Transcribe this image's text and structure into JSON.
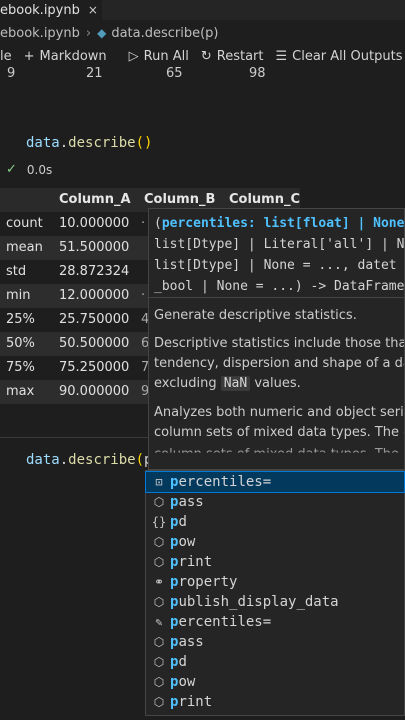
{
  "tab": {
    "title": "ebook.ipynb",
    "close_glyph": "×"
  },
  "breadcrumb": {
    "file": "ebook.ipynb",
    "separator": "›",
    "symbol": "data.describe(p)"
  },
  "toolbar": {
    "items": [
      {
        "label": "le",
        "icon": ""
      },
      {
        "label": "Markdown",
        "icon": "+"
      },
      {
        "label": "Run All",
        "icon": "▷"
      },
      {
        "label": "Restart",
        "icon": "↻"
      },
      {
        "label": "Clear All Outputs",
        "icon": "☰"
      }
    ]
  },
  "prev_output": [
    "9",
    "21",
    "65",
    "98"
  ],
  "code_cell_1": {
    "var": "data",
    "dot": ".",
    "fn": "describe",
    "args": "()"
  },
  "exec_status": {
    "time": "0.0s"
  },
  "dataframe": {
    "columns": [
      "Column_A",
      "Column_B",
      "Column_C"
    ],
    "rows": [
      {
        "index": "count",
        "value": "10.000000",
        "cut": "·"
      },
      {
        "index": "mean",
        "value": "51.500000",
        "cut": ""
      },
      {
        "index": "std",
        "value": "28.872324",
        "cut": ""
      },
      {
        "index": "min",
        "value": "12.000000",
        "cut": "·"
      },
      {
        "index": "25%",
        "value": "25.750000",
        "cut": "4"
      },
      {
        "index": "50%",
        "value": "50.500000",
        "cut": "6"
      },
      {
        "index": "75%",
        "value": "75.250000",
        "cut": "7"
      },
      {
        "index": "max",
        "value": "90.000000",
        "cut": "9"
      }
    ]
  },
  "code_cell_2": {
    "var": "data",
    "dot": ".",
    "fn": "describe",
    "open": "(",
    "typed": "p",
    "close": ")"
  },
  "hover": {
    "sig_line1_paren": "(",
    "sig_line1_param": "percentiles: list[float] | None",
    "sig_line2": "list[Dtype] | Literal['all'] | N",
    "sig_line3": "list[Dtype] | None = ..., datet",
    "sig_line4": "_bool | None = ...) -> DataFrame",
    "doc_summary": "Generate descriptive statistics.",
    "doc_p1_l1": "Descriptive statistics include those that s",
    "doc_p1_l2": "tendency, dispersion and shape of a data",
    "doc_p1_l3_pre": "excluding ",
    "doc_p1_l3_code": "NaN",
    "doc_p1_l3_post": " values.",
    "doc_p2_l1": "Analyzes both numeric and object series",
    "doc_p2_l2": "column sets of mixed data types. The ou",
    "doc_p2_l3": "column sets of mixed data types. The ou"
  },
  "suggestions": [
    {
      "match": "p",
      "rest": "ercentiles=",
      "icon": "variable-icon",
      "glyph": "⊡",
      "selected": true
    },
    {
      "match": "p",
      "rest": "ass",
      "icon": "keyword-icon",
      "glyph": "⬡",
      "selected": false
    },
    {
      "match": "p",
      "rest": "d",
      "icon": "module-icon",
      "glyph": "{}",
      "selected": false
    },
    {
      "match": "p",
      "rest": "ow",
      "icon": "method-icon",
      "glyph": "⬡",
      "selected": false
    },
    {
      "match": "p",
      "rest": "rint",
      "icon": "method-icon",
      "glyph": "⬡",
      "selected": false
    },
    {
      "match": "p",
      "rest": "roperty",
      "icon": "class-icon",
      "glyph": "⚭",
      "selected": false
    },
    {
      "match": "p",
      "rest": "ublish_display_data",
      "icon": "method-icon",
      "glyph": "⬡",
      "selected": false
    },
    {
      "match": "p",
      "rest": "ercentiles=",
      "icon": "wrench-icon",
      "glyph": "✎",
      "selected": false
    },
    {
      "match": "p",
      "rest": "ass",
      "icon": "method-icon",
      "glyph": "⬡",
      "selected": false
    },
    {
      "match": "p",
      "rest": "d",
      "icon": "method-icon",
      "glyph": "⬡",
      "selected": false
    },
    {
      "match": "p",
      "rest": "ow",
      "icon": "method-icon",
      "glyph": "⬡",
      "selected": false
    },
    {
      "match": "p",
      "rest": "rint",
      "icon": "method-icon",
      "glyph": "⬡",
      "selected": false
    }
  ]
}
